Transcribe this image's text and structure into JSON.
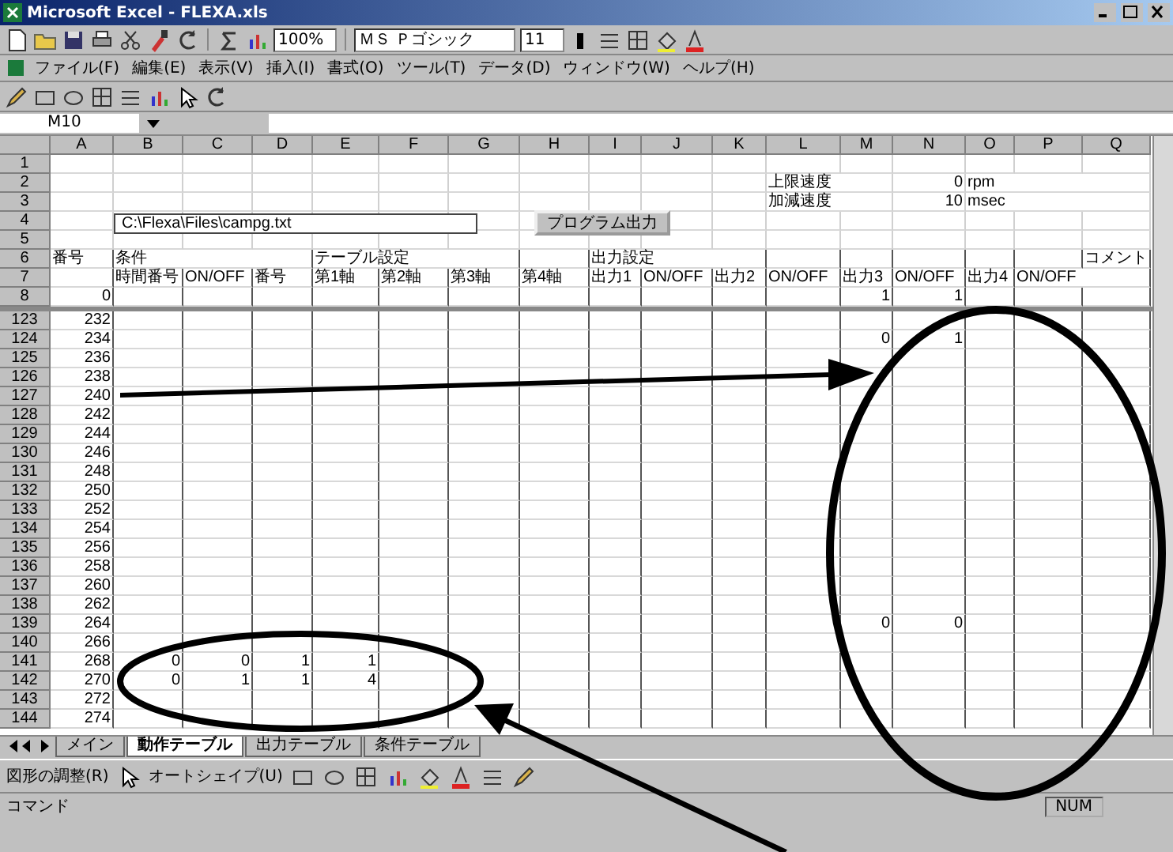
{
  "window": {
    "title": "Microsoft Excel - FLEXA.xls"
  },
  "toolbar": {
    "zoom": "100%",
    "font": "ＭＳ Ｐゴシック",
    "size": "11"
  },
  "menu": [
    "ファイル(F)",
    "編集(E)",
    "表示(V)",
    "挿入(I)",
    "書式(O)",
    "ツール(T)",
    "データ(D)",
    "ウィンドウ(W)",
    "ヘルプ(H)"
  ],
  "formula_bar": {
    "name_box": "M10"
  },
  "sheet": {
    "columns": [
      "A",
      "B",
      "C",
      "D",
      "E",
      "F",
      "G",
      "H",
      "I",
      "J",
      "K",
      "L",
      "M",
      "N",
      "O",
      "P",
      "Q"
    ],
    "path_field": {
      "value": "C:\\Flexa\\Files\\campg.txt"
    },
    "output_button": "プログラム出力",
    "top_rows": [
      {
        "header": "1",
        "cells": {}
      },
      {
        "header": "2",
        "cells": {
          "L": "上限速度",
          "N": "0",
          "O": "rpm"
        }
      },
      {
        "header": "3",
        "cells": {
          "L": "加減速度",
          "N": "10",
          "O": "msec"
        }
      },
      {
        "header": "4",
        "cells": {}
      },
      {
        "header": "5",
        "cells": {}
      },
      {
        "header": "6",
        "cells": {
          "A": "番号",
          "B": "条件",
          "E": "テーブル設定",
          "I": "出力設定",
          "Q": "コメント"
        }
      },
      {
        "header": "7",
        "cells": {
          "B": "時間番号",
          "C": "ON/OFF",
          "D": "番号",
          "E": "第1軸",
          "F": "第2軸",
          "G": "第3軸",
          "H": "第4軸",
          "I": "出力1",
          "J": "ON/OFF",
          "K": "出力2",
          "L": "ON/OFF",
          "M": "出力3",
          "N": "ON/OFF",
          "O": "出力4",
          "P": "ON/OFF"
        }
      },
      {
        "header": "8",
        "cells": {
          "A": "0",
          "M": "1",
          "N": "1"
        }
      }
    ],
    "rows": [
      {
        "header": "123",
        "cells": {
          "A": "232"
        }
      },
      {
        "header": "124",
        "cells": {
          "A": "234",
          "M": "0",
          "N": "1"
        }
      },
      {
        "header": "125",
        "cells": {
          "A": "236"
        }
      },
      {
        "header": "126",
        "cells": {
          "A": "238"
        }
      },
      {
        "header": "127",
        "cells": {
          "A": "240"
        }
      },
      {
        "header": "128",
        "cells": {
          "A": "242"
        }
      },
      {
        "header": "129",
        "cells": {
          "A": "244"
        }
      },
      {
        "header": "130",
        "cells": {
          "A": "246"
        }
      },
      {
        "header": "131",
        "cells": {
          "A": "248"
        }
      },
      {
        "header": "132",
        "cells": {
          "A": "250"
        }
      },
      {
        "header": "133",
        "cells": {
          "A": "252"
        }
      },
      {
        "header": "134",
        "cells": {
          "A": "254"
        }
      },
      {
        "header": "135",
        "cells": {
          "A": "256"
        }
      },
      {
        "header": "136",
        "cells": {
          "A": "258"
        }
      },
      {
        "header": "137",
        "cells": {
          "A": "260"
        }
      },
      {
        "header": "138",
        "cells": {
          "A": "262"
        }
      },
      {
        "header": "139",
        "cells": {
          "A": "264",
          "M": "0",
          "N": "0"
        }
      },
      {
        "header": "140",
        "cells": {
          "A": "266"
        }
      },
      {
        "header": "141",
        "cells": {
          "A": "268",
          "B": "0",
          "C": "0",
          "D": "1",
          "E": "1"
        }
      },
      {
        "header": "142",
        "cells": {
          "A": "270",
          "B": "0",
          "C": "1",
          "D": "1",
          "E": "4"
        }
      },
      {
        "header": "143",
        "cells": {
          "A": "272"
        }
      },
      {
        "header": "144",
        "cells": {
          "A": "274"
        }
      }
    ]
  },
  "sheet_tabs": [
    {
      "label": "メイン",
      "selected": false
    },
    {
      "label": "動作テーブル",
      "selected": true
    },
    {
      "label": "出力テーブル",
      "selected": false
    },
    {
      "label": "条件テーブル",
      "selected": false
    }
  ],
  "drawing_toolbar": {
    "draw_menu": "図形の調整(R)",
    "autoshape_menu": "オートシェイプ(U)"
  },
  "status_bar": {
    "mode": "コマンド",
    "indicator": "NUM"
  }
}
